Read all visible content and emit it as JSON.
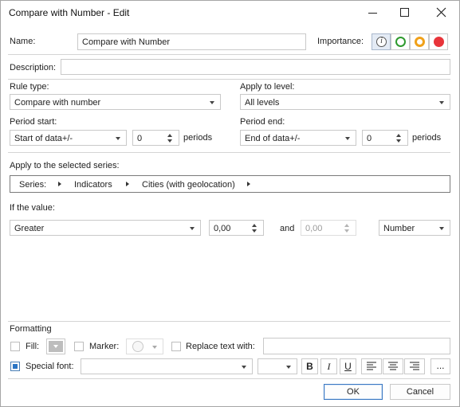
{
  "window": {
    "title": "Compare with Number - Edit"
  },
  "name": {
    "label": "Name:",
    "value": "Compare with Number"
  },
  "importance": {
    "label": "Importance:",
    "info_glyph": "i",
    "colors": {
      "green": "#2e9a2e",
      "orange": "#f0a11a",
      "red": "#e8343a"
    }
  },
  "description": {
    "label": "Description:",
    "value": ""
  },
  "rule_type": {
    "label": "Rule type:",
    "value": "Compare with number"
  },
  "apply_level": {
    "label": "Apply to level:",
    "value": "All levels"
  },
  "period_start": {
    "label": "Period start:",
    "value": "Start of data+/-",
    "count": "0",
    "unit": "periods"
  },
  "period_end": {
    "label": "Period end:",
    "value": "End of data+/-",
    "count": "0",
    "unit": "periods"
  },
  "series": {
    "label": "Apply to the selected series:",
    "items": [
      "Series:",
      "Indicators",
      "Cities (with geolocation)"
    ]
  },
  "condition": {
    "label": "If the value:",
    "operator": "Greater",
    "value1": "0,00",
    "and_label": "and",
    "value2": "0,00",
    "format": "Number"
  },
  "formatting": {
    "label": "Formatting",
    "fill_label": "Fill:",
    "marker_label": "Marker:",
    "replace_label": "Replace text with:",
    "replace_value": "",
    "special_font_label": "Special font:",
    "font_value": "",
    "size_value": "",
    "bold": "B",
    "italic": "I",
    "underline": "U",
    "more": "...",
    "accent_color": "#2b75c4"
  },
  "buttons": {
    "ok": "OK",
    "cancel": "Cancel"
  }
}
